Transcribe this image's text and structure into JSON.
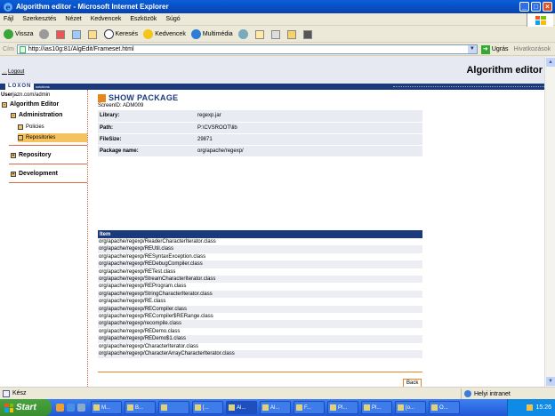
{
  "window": {
    "title": "Algorithm editor - Microsoft Internet Explorer",
    "buttons": [
      "_",
      "□",
      "×"
    ]
  },
  "menu": [
    "Fájl",
    "Szerkesztés",
    "Nézet",
    "Kedvencek",
    "Eszközök",
    "Súgó"
  ],
  "toolbar": {
    "back": "Vissza",
    "search": "Keresés",
    "favorites": "Kedvencek",
    "media": "Multimédia"
  },
  "address": {
    "label": "Cím",
    "url": "http://ias10g:81/AlgEdit/Frameset.html",
    "go": "Ugrás",
    "links": "Hivatkozások"
  },
  "app": {
    "logout": "Logout",
    "title": "Algorithm editor",
    "logo": "LOXON",
    "logo_sub": "solutions"
  },
  "sidebar": {
    "user_label": "User",
    "user": "jazn.com/admin",
    "tree_title": "Algorithm Editor",
    "administration": "Administration",
    "policies": "Policies",
    "repositories": "Repositories",
    "repository": "Repository",
    "development": "Development"
  },
  "main": {
    "title": "SHOW PACKAGE",
    "screen_id": "ScreenID: ADM009",
    "info": [
      {
        "key": "Library:",
        "value": "regexp.jar"
      },
      {
        "key": "Path:",
        "value": "P:\\CVSROOT\\lib"
      },
      {
        "key": "FileSize:",
        "value": "29871"
      },
      {
        "key": "Package name:",
        "value": "org/apache/regexp/"
      }
    ],
    "items_header": "Item",
    "items": [
      "org/apache/regexp/ReaderCharacterIterator.class",
      "org/apache/regexp/REUtil.class",
      "org/apache/regexp/RESyntaxException.class",
      "org/apache/regexp/REDebugCompiler.class",
      "org/apache/regexp/RETest.class",
      "org/apache/regexp/StreamCharacterIterator.class",
      "org/apache/regexp/REProgram.class",
      "org/apache/regexp/StringCharacterIterator.class",
      "org/apache/regexp/RE.class",
      "org/apache/regexp/RECompiler.class",
      "org/apache/regexp/RECompiler$RERange.class",
      "org/apache/regexp/recompile.class",
      "org/apache/regexp/REDemo.class",
      "org/apache/regexp/REDemo$1.class",
      "org/apache/regexp/CharacterIterator.class",
      "org/apache/regexp/CharacterArrayCharacterIterator.class"
    ],
    "back": "Back"
  },
  "status": {
    "text": "Kész",
    "zone": "Helyi intranet"
  },
  "taskbar": {
    "start": "Start",
    "tasks": [
      "M...",
      "B...",
      "",
      "[...",
      "Al...",
      "Al...",
      "F...",
      "Pl...",
      "Pl...",
      "[o...",
      "O..."
    ],
    "clock": "15:26"
  }
}
